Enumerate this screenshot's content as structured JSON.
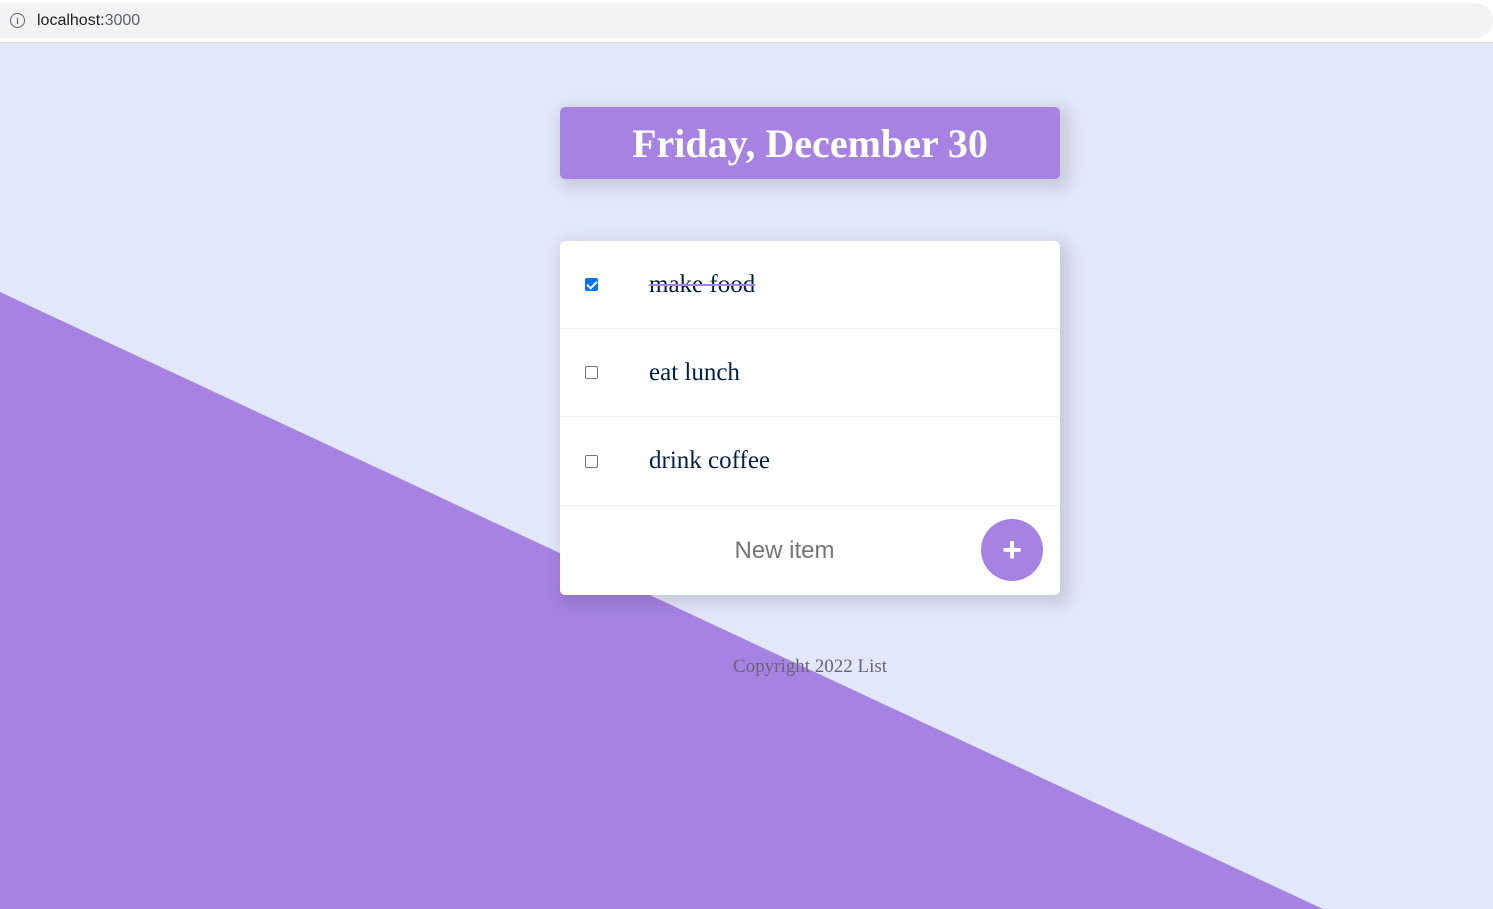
{
  "browser": {
    "url_host": "localhost:",
    "url_port": "3000",
    "info_icon": "info-icon"
  },
  "colors": {
    "background": "#E3E7FA",
    "accent": "#A683E3",
    "text": "#00204A",
    "checkbox_checked": "#0075FF"
  },
  "heading": {
    "title": "Friday, December 30"
  },
  "list": {
    "items": [
      {
        "label": "make food",
        "checked": true
      },
      {
        "label": "eat lunch",
        "checked": false
      },
      {
        "label": "drink coffee",
        "checked": false
      }
    ]
  },
  "new_item": {
    "placeholder": "New item",
    "add_label": "+"
  },
  "footer": {
    "text": "Copyright 2022 List"
  }
}
